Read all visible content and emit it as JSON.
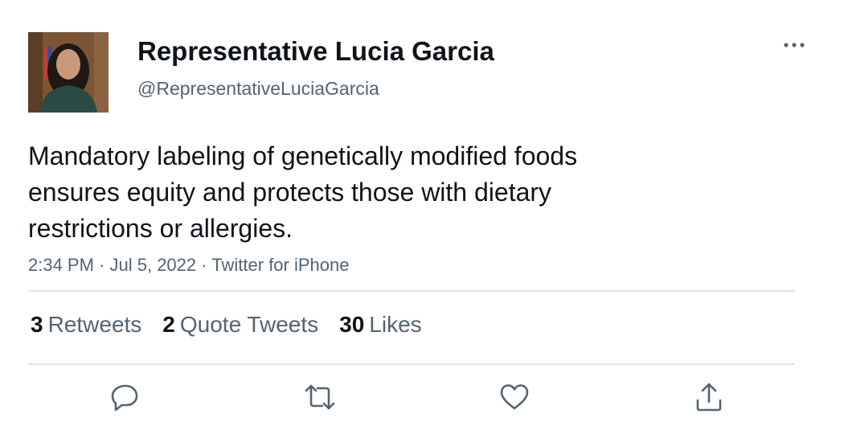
{
  "user": {
    "display_name": "Representative Lucia Garcia",
    "handle": "@RepresentativeLuciaGarcia"
  },
  "tweet": {
    "text": "Mandatory labeling of genetically modified foods ensures equity and protects those with dietary restrictions or allergies.",
    "time": "2:34 PM",
    "date": "Jul 5, 2022",
    "source": "Twitter for iPhone",
    "separator": " · "
  },
  "stats": {
    "retweets": {
      "count": "3",
      "label": "Retweets"
    },
    "quote_tweets": {
      "count": "2",
      "label": "Quote Tweets"
    },
    "likes": {
      "count": "30",
      "label": "Likes"
    }
  },
  "icons": {
    "more": "more-horizontal-icon",
    "reply": "reply-icon",
    "retweet": "retweet-icon",
    "like": "heart-icon",
    "share": "share-icon"
  },
  "colors": {
    "text_primary": "#0f1419",
    "text_secondary": "#536471",
    "divider": "#e1e4e6"
  }
}
